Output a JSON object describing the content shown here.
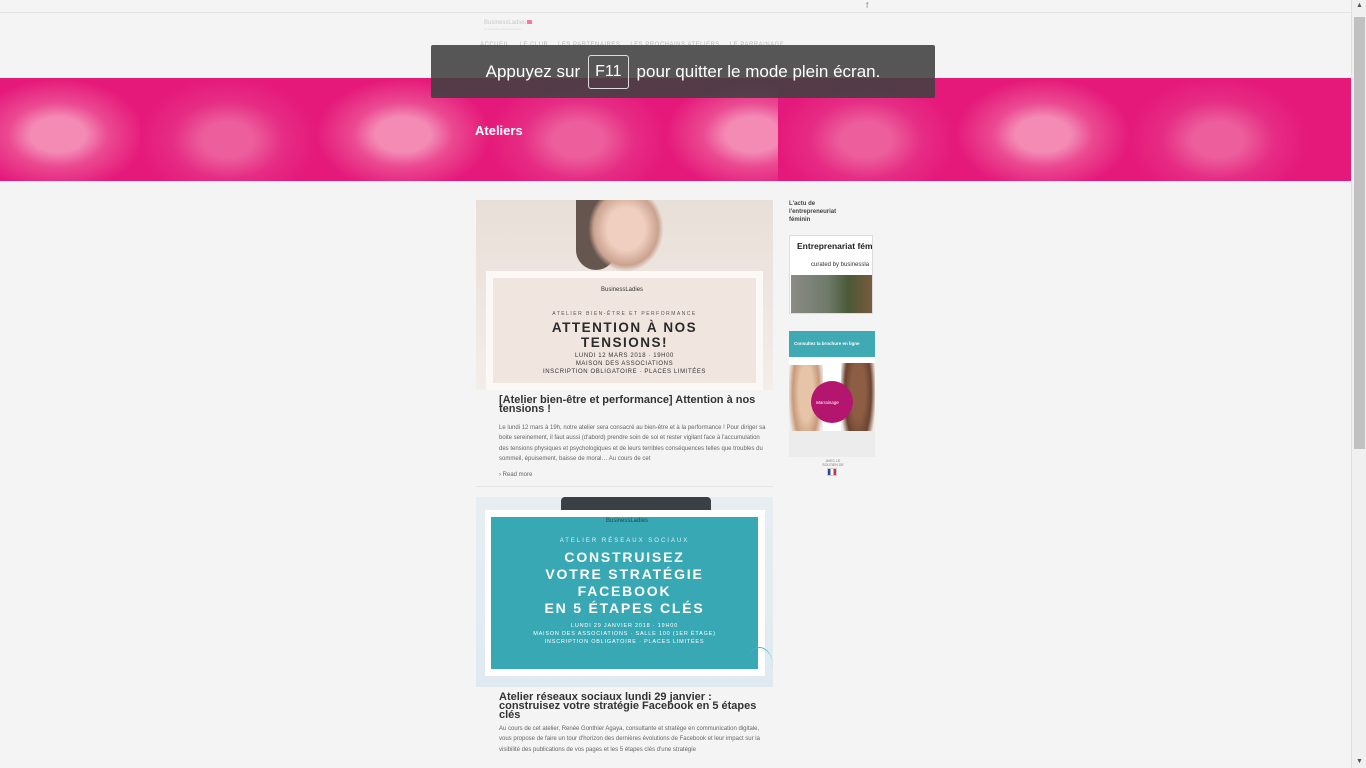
{
  "topbar": {
    "social_icon": "f"
  },
  "header": {
    "logo_line1": "BusinessLadies",
    "logo_line2": "Le club des entrepreneuses",
    "nav": [
      "ACCUEIL",
      "LE CLUB",
      "LES PARTENAIRES",
      "LES PROCHAINS ATELIERS",
      "LE PARRAINAGE"
    ]
  },
  "fullscreen_notice": {
    "before": "Appuyez sur",
    "key": "F11",
    "after": "pour quitter le mode plein écran."
  },
  "banner": {
    "title": "Ateliers"
  },
  "posts": [
    {
      "image": {
        "logo": "BusinessLadies",
        "subtitle": "ATELIER BIEN-ÊTRE ET PERFORMANCE",
        "headline_1": "ATTENTION À NOS",
        "headline_2": "TENSIONS!",
        "meta_1": "LUNDI 12 MARS 2018 · 19H00",
        "meta_2": "MAISON DES ASSOCIATIONS",
        "meta_3": "INSCRIPTION OBLIGATOIRE · PLACES LIMITÉES"
      },
      "title": "[Atelier bien-être et performance] Attention à nos tensions !",
      "excerpt": "Le lundi 12 mars à 19h, notre atelier sera consacré au bien-être et à la performance ! Pour diriger sa boite sereinement, il faut aussi (d'abord) prendre soin de soi et rester vigilant face à l'accumulation des tensions physiques et psychologiques et de leurs terribles conséquences telles que troubles du sommeil, épuisement, baisse de moral… Au cours de cet",
      "read_more": "Read more"
    },
    {
      "image": {
        "logo": "BusinessLadies",
        "subtitle": "ATELIER RÉSEAUX SOCIAUX",
        "headline_1": "CONSTRUISEZ",
        "headline_2": "VOTRE STRATÉGIE",
        "headline_3": "FACEBOOK",
        "headline_4": "EN 5 ÉTAPES CLÉS",
        "meta_1": "LUNDI 29 JANVIER 2018 · 19H00",
        "meta_2": "MAISON DES ASSOCIATIONS · SALLE 100 (1ER ÉTAGE)",
        "meta_3": "INSCRIPTION OBLIGATOIRE · PLACES LIMITÉES"
      },
      "title": "Atelier réseaux sociaux lundi 29 janvier : construisez votre stratégie Facebook en 5 étapes clés",
      "excerpt": "Au cours de cet atelier, Renée Gonthier Agaya, consultante et stratège en communication digitale, vous propose de faire un tour d'horizon des dernières évolutions de Facebook et leur impact sur la visibilité des publications de vos pages et les 5 étapes clés d'une stratégie"
    }
  ],
  "sidebar": {
    "widget_title": "L'actu de l'entrepreneuriat féminin",
    "scoopit_title": "Entreprenariat fém",
    "scoopit_curated": "curated by businessla",
    "brochure_header": "Consultez la brochure en ligne",
    "brochure_circle": "Marrainage",
    "flag_caption": "AVEC LE SOUTIEN DE"
  }
}
